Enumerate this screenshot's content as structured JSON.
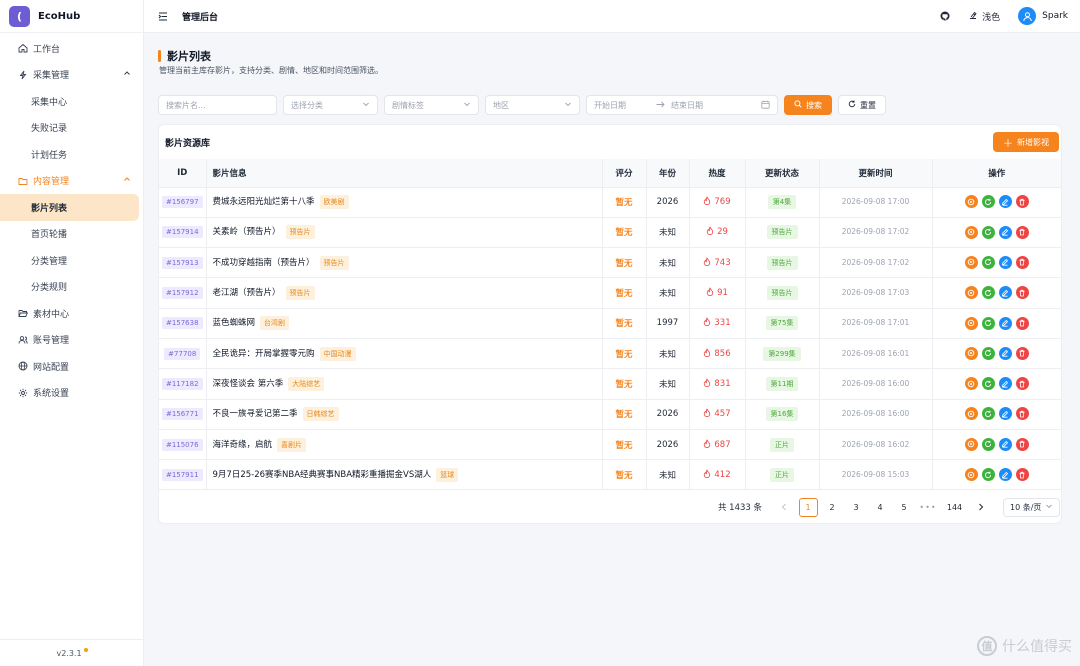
{
  "brand": {
    "logo_char": "(",
    "name": "EcoHub"
  },
  "sidebar": {
    "items": [
      {
        "key": "workbench",
        "label": "工作台",
        "icon": "home-icon"
      },
      {
        "key": "collect",
        "label": "采集管理",
        "icon": "lightning-icon",
        "expanded": true,
        "children": [
          "采集中心",
          "失败记录",
          "计划任务"
        ]
      },
      {
        "key": "content",
        "label": "内容管理",
        "icon": "folder-icon",
        "expanded": true,
        "children": [
          "影片列表",
          "首页轮播",
          "分类管理",
          "分类规则"
        ],
        "active_child": "影片列表"
      },
      {
        "key": "assets",
        "label": "素材中心",
        "icon": "folder-open-icon"
      },
      {
        "key": "accounts",
        "label": "账号管理",
        "icon": "users-icon"
      },
      {
        "key": "site",
        "label": "网站配置",
        "icon": "globe-icon"
      },
      {
        "key": "system",
        "label": "系统设置",
        "icon": "gear-icon"
      }
    ],
    "version": "v2.3.1"
  },
  "topbar": {
    "title": "管理后台",
    "theme_label": "浅色",
    "user_name": "Spark"
  },
  "page": {
    "title": "影片列表",
    "description": "管理当前主库存影片，支持分类、剧情、地区和时间范围筛选。"
  },
  "filters": {
    "search_placeholder": "搜索片名...",
    "category_placeholder": "选择分类",
    "tag_placeholder": "剧情标签",
    "region_placeholder": "地区",
    "start_date_placeholder": "开始日期",
    "end_date_placeholder": "结束日期",
    "search_label": "搜索",
    "reset_label": "重置"
  },
  "table": {
    "title": "影片资源库",
    "add_label": "新增影视",
    "columns": [
      "ID",
      "影片信息",
      "评分",
      "年份",
      "热度",
      "更新状态",
      "更新时间",
      "操作"
    ],
    "rows": [
      {
        "id": "#156797",
        "title": "费城永远阳光灿烂第十八季",
        "tag": "欧美剧",
        "rating": "暂无",
        "year": "2026",
        "heat": "769",
        "status": "第4集",
        "time": "2026-09-08 17:00"
      },
      {
        "id": "#157914",
        "title": "关素岭（预告片）",
        "tag": "预告片",
        "rating": "暂无",
        "year": "未知",
        "heat": "29",
        "status": "预告片",
        "time": "2026-09-08 17:02"
      },
      {
        "id": "#157913",
        "title": "不成功穿越指南（预告片）",
        "tag": "预告片",
        "rating": "暂无",
        "year": "未知",
        "heat": "743",
        "status": "预告片",
        "time": "2026-09-08 17:02"
      },
      {
        "id": "#157912",
        "title": "老江湖（预告片）",
        "tag": "预告片",
        "rating": "暂无",
        "year": "未知",
        "heat": "91",
        "status": "预告片",
        "time": "2026-09-08 17:03"
      },
      {
        "id": "#157638",
        "title": "蓝色蜘蛛网",
        "tag": "台湾剧",
        "rating": "暂无",
        "year": "1997",
        "heat": "331",
        "status": "第75集",
        "time": "2026-09-08 17:01"
      },
      {
        "id": "#77708",
        "title": "全民诡异：开局掌握零元购",
        "tag": "中国动漫",
        "rating": "暂无",
        "year": "未知",
        "heat": "856",
        "status": "第299集",
        "time": "2026-09-08 16:01"
      },
      {
        "id": "#117182",
        "title": "深夜怪谈会 第六季",
        "tag": "大陆综艺",
        "rating": "暂无",
        "year": "未知",
        "heat": "831",
        "status": "第11期",
        "time": "2026-09-08 16:00"
      },
      {
        "id": "#156771",
        "title": "不良一族寻爱记第二季",
        "tag": "日韩综艺",
        "rating": "暂无",
        "year": "2026",
        "heat": "457",
        "status": "第16集",
        "time": "2026-09-08 16:00"
      },
      {
        "id": "#115076",
        "title": "海洋奇缘，启航",
        "tag": "喜剧片",
        "rating": "暂无",
        "year": "2026",
        "heat": "687",
        "status": "正片",
        "time": "2026-09-08 16:02"
      },
      {
        "id": "#157911",
        "title": "9月7日25-26赛季NBA经典赛事NBA精彩重播掘金VS湖人",
        "tag": "篮球",
        "rating": "暂无",
        "year": "未知",
        "heat": "412",
        "status": "正片",
        "time": "2026-09-08 15:03"
      }
    ]
  },
  "pagination": {
    "total": "共 1433 条",
    "pages": [
      "1",
      "2",
      "3",
      "4",
      "5"
    ],
    "current": "1",
    "ellipsis": "•••",
    "last": "144",
    "page_size": "10 条/页"
  },
  "watermark": {
    "icon_char": "值",
    "text": "什么值得买"
  },
  "colors": {
    "accent": "#f5841f",
    "brand": "#6d5dd3",
    "active_bg": "#fde6c7"
  }
}
